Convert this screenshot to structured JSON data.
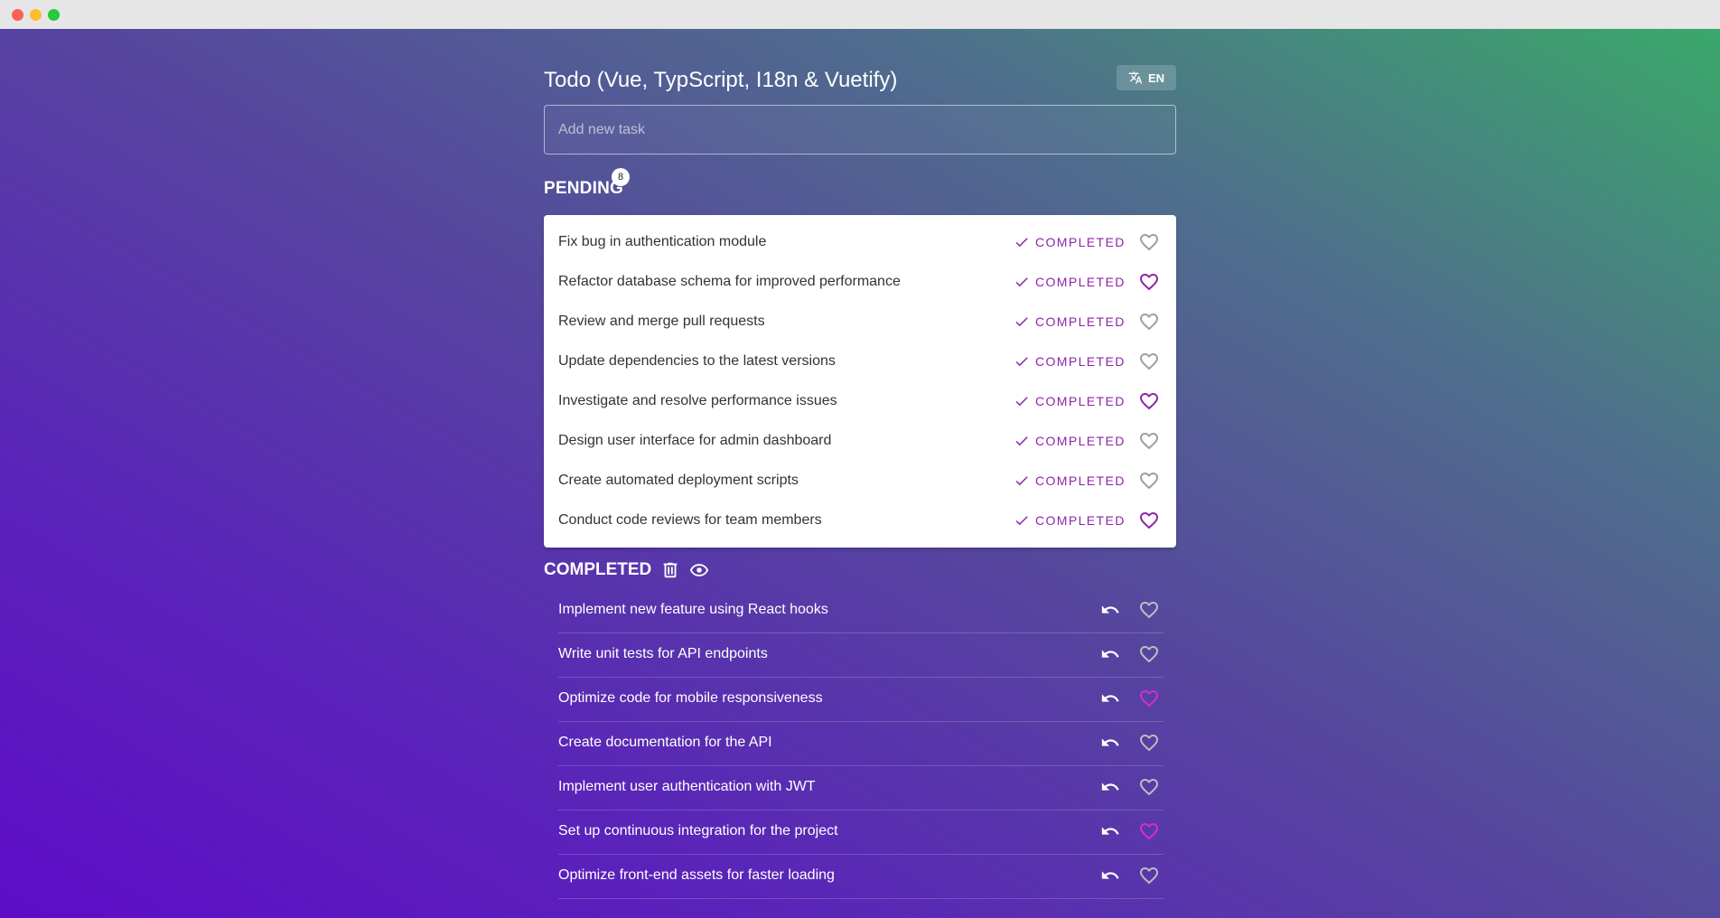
{
  "app": {
    "title": "Todo (Vue, TypScript, I18n & Vuetify)",
    "language_label": "EN"
  },
  "new_task": {
    "placeholder": "Add new task",
    "value": ""
  },
  "pending": {
    "title": "PENDING",
    "count": "8",
    "complete_label": "COMPLETED",
    "items": [
      {
        "text": "Fix bug in authentication module",
        "favorite": false
      },
      {
        "text": "Refactor database schema for improved performance",
        "favorite": true
      },
      {
        "text": "Review and merge pull requests",
        "favorite": false
      },
      {
        "text": "Update dependencies to the latest versions",
        "favorite": false
      },
      {
        "text": "Investigate and resolve performance issues",
        "favorite": true
      },
      {
        "text": "Design user interface for admin dashboard",
        "favorite": false
      },
      {
        "text": "Create automated deployment scripts",
        "favorite": false
      },
      {
        "text": "Conduct code reviews for team members",
        "favorite": true
      }
    ]
  },
  "completed": {
    "title": "COMPLETED",
    "items": [
      {
        "text": "Implement new feature using React hooks",
        "favorite": false
      },
      {
        "text": "Write unit tests for API endpoints",
        "favorite": false
      },
      {
        "text": "Optimize code for mobile responsiveness",
        "favorite": true
      },
      {
        "text": "Create documentation for the API",
        "favorite": false
      },
      {
        "text": "Implement user authentication with JWT",
        "favorite": false
      },
      {
        "text": "Set up continuous integration for the project",
        "favorite": true
      },
      {
        "text": "Optimize front-end assets for faster loading",
        "favorite": false
      }
    ]
  },
  "colors": {
    "accent": "#8e24aa",
    "heart_inactive": "#9e9e9e",
    "heart_inactive_dark": "#bdbdbd",
    "heart_active_dark": "#d42bd6"
  }
}
